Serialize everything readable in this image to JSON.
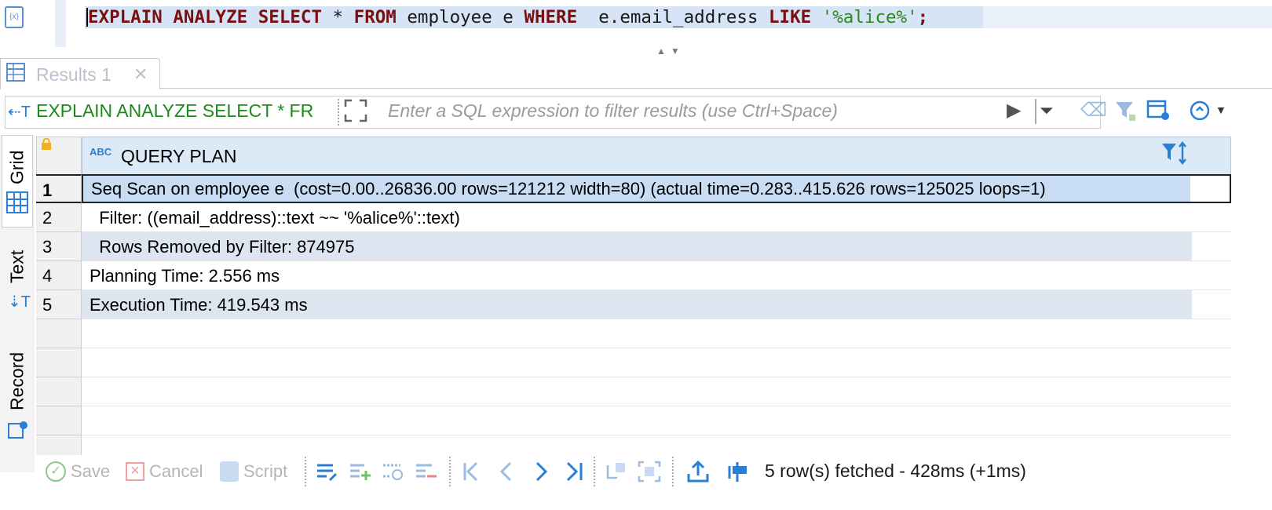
{
  "editor": {
    "sql_tokens": [
      {
        "t": "EXPLAIN ANALYZE SELECT",
        "c": "kw"
      },
      {
        "t": " * ",
        "c": "plain"
      },
      {
        "t": "FROM",
        "c": "kw"
      },
      {
        "t": " employee e ",
        "c": "plain"
      },
      {
        "t": "WHERE",
        "c": "kw"
      },
      {
        "t": "  e.email_address ",
        "c": "plain"
      },
      {
        "t": "LIKE",
        "c": "kw"
      },
      {
        "t": " ",
        "c": "plain"
      },
      {
        "t": "'%alice%'",
        "c": "str"
      },
      {
        "t": ";",
        "c": "kw"
      }
    ]
  },
  "tab": {
    "label": "Results 1",
    "close": "✕"
  },
  "filter": {
    "query_label": "EXPLAIN ANALYZE SELECT * FR",
    "placeholder": "Enter a SQL expression to filter results (use Ctrl+Space)"
  },
  "side_tabs": {
    "grid": "Grid",
    "text": "Text",
    "record": "Record"
  },
  "grid": {
    "column_type_badge": "ABC",
    "column_header": "QUERY PLAN",
    "rows": [
      {
        "num": "1",
        "text": "Seq Scan on employee e  (cost=0.00..26836.00 rows=121212 width=80) (actual time=0.283..415.626 rows=125025 loops=1)"
      },
      {
        "num": "2",
        "text": "  Filter: ((email_address)::text ~~ '%alice%'::text)"
      },
      {
        "num": "3",
        "text": "  Rows Removed by Filter: 874975"
      },
      {
        "num": "4",
        "text": "Planning Time: 2.556 ms"
      },
      {
        "num": "5",
        "text": "Execution Time: 419.543 ms"
      }
    ]
  },
  "bottom": {
    "save": "Save",
    "cancel": "Cancel",
    "script": "Script",
    "status": "5 row(s) fetched - 428ms (+1ms)"
  },
  "colors": {
    "accent": "#2a7fd4",
    "keyword": "#7a0f0f",
    "string": "#2a8a1e",
    "selected_row": "#c8dcf4",
    "alt_row": "#dce5f0"
  }
}
